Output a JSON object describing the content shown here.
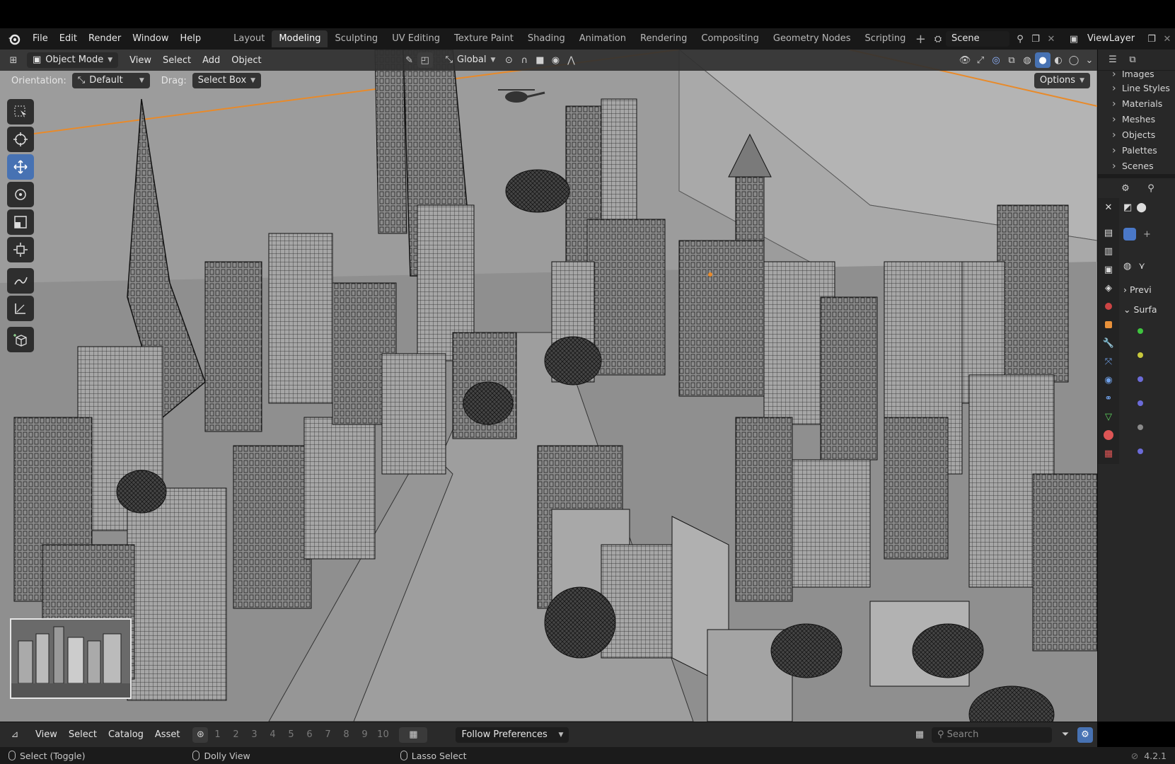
{
  "menubar": {
    "items": [
      "File",
      "Edit",
      "Render",
      "Window",
      "Help"
    ],
    "workspaces": [
      "Layout",
      "Modeling",
      "Sculpting",
      "UV Editing",
      "Texture Paint",
      "Shading",
      "Animation",
      "Rendering",
      "Compositing",
      "Geometry Nodes",
      "Scripting"
    ],
    "active_workspace": "Modeling",
    "scene_name": "Scene",
    "view_layer": "ViewLayer"
  },
  "viewport_header": {
    "mode": "Object Mode",
    "menus": [
      "View",
      "Select",
      "Add",
      "Object"
    ],
    "transform_orientation": "Global",
    "options_label": "Options"
  },
  "tool_settings": {
    "orientation_label": "Orientation:",
    "orientation_value": "Default",
    "drag_label": "Drag:",
    "drag_value": "Select Box"
  },
  "toolbar": {
    "tools": [
      "select-box",
      "cursor",
      "move",
      "rotate",
      "scale",
      "transform",
      "annotate",
      "measure",
      "add-cube"
    ],
    "active_tool": "move"
  },
  "outliner": {
    "items": [
      "Images",
      "Line Styles",
      "Materials",
      "Meshes",
      "Objects",
      "Palettes",
      "Scenes"
    ]
  },
  "properties": {
    "panel_preview": "Previ",
    "panel_surface": "Surfa"
  },
  "asset_bar": {
    "menus": [
      "View",
      "Select",
      "Catalog",
      "Asset"
    ],
    "numbers": [
      "1",
      "2",
      "3",
      "4",
      "5",
      "6",
      "7",
      "8",
      "9",
      "10"
    ],
    "library": "Follow Preferences",
    "search_placeholder": "Search"
  },
  "statusbar": {
    "left_hint": "Select (Toggle)",
    "middle_hint": "Dolly View",
    "right_hint": "Lasso Select",
    "version": "4.2.1"
  },
  "colors": {
    "accent_blue": "#4772b3",
    "viewport_gray": "#9a9a9a",
    "header_dark": "#181818",
    "orange_line": "#e88a2a"
  }
}
